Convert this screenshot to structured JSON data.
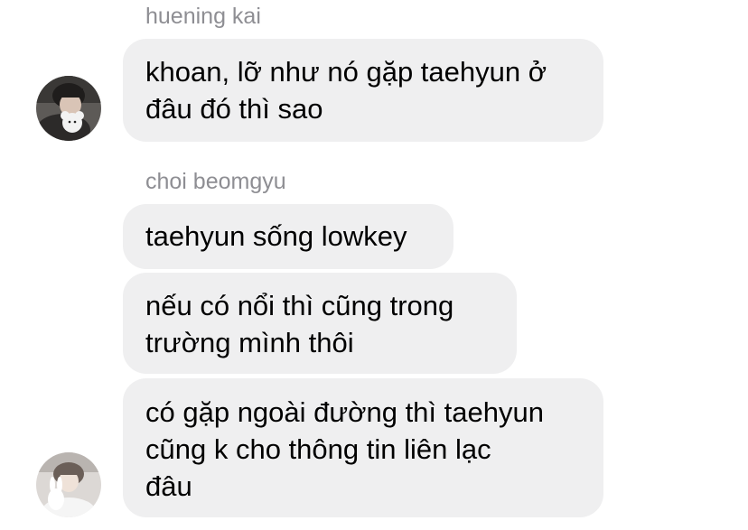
{
  "conversation": {
    "groups": [
      {
        "sender": "huening kai",
        "avatar_icon": "profile-photo-boy-with-plush-toy",
        "messages": [
          {
            "lines": [
              "khoan, lỡ như nó gặp taehyun ở",
              "đâu đó thì sao"
            ]
          }
        ]
      },
      {
        "sender": "choi beomgyu",
        "avatar_icon": "profile-photo-boy-with-bunny-plush",
        "messages": [
          {
            "lines": [
              "taehyun sống lowkey"
            ]
          },
          {
            "lines": [
              "nếu có nổi thì cũng trong",
              "trường mình thôi"
            ]
          },
          {
            "lines": [
              "có gặp ngoài đường thì taehyun",
              "cũng k cho thông tin liên lạc",
              "đâu"
            ]
          }
        ]
      }
    ]
  },
  "colors": {
    "bubble_background": "#efeff0",
    "sender_name": "#8e8e93",
    "message_text": "#000000",
    "page_background": "#ffffff"
  }
}
